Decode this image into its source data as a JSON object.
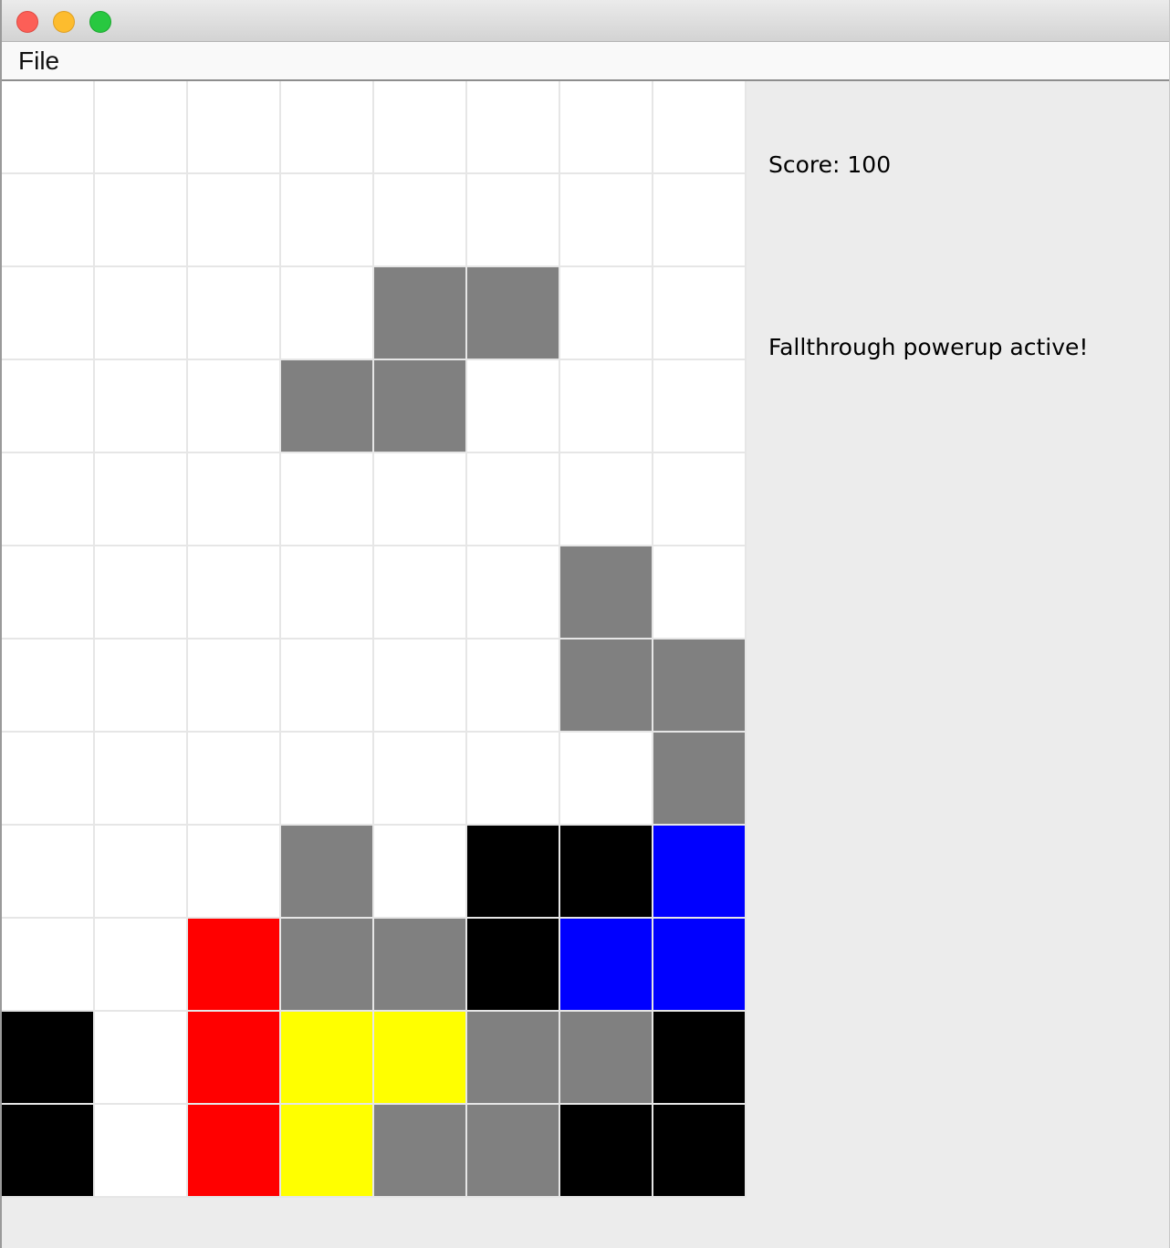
{
  "window": {
    "controls": [
      "close",
      "minimize",
      "maximize"
    ]
  },
  "menubar": {
    "items": [
      {
        "label": "File"
      }
    ]
  },
  "sidebar": {
    "score_text": "Score: 100",
    "status_text": "Fallthrough powerup active!"
  },
  "board": {
    "columns": 8,
    "rows": 12,
    "colors": {
      "empty": "#ffffff",
      "G": "#808080",
      "K": "#000000",
      "B": "#0000ff",
      "R": "#ff0000",
      "Y": "#ffff00"
    },
    "grid": [
      "........",
      "........",
      "....GG..",
      "...GG...",
      "........",
      "......G.",
      "......GG",
      ".......G",
      "...G.KKB",
      "..RGGKBB",
      "K.RYYGGK",
      "K.RYGGKK"
    ]
  }
}
